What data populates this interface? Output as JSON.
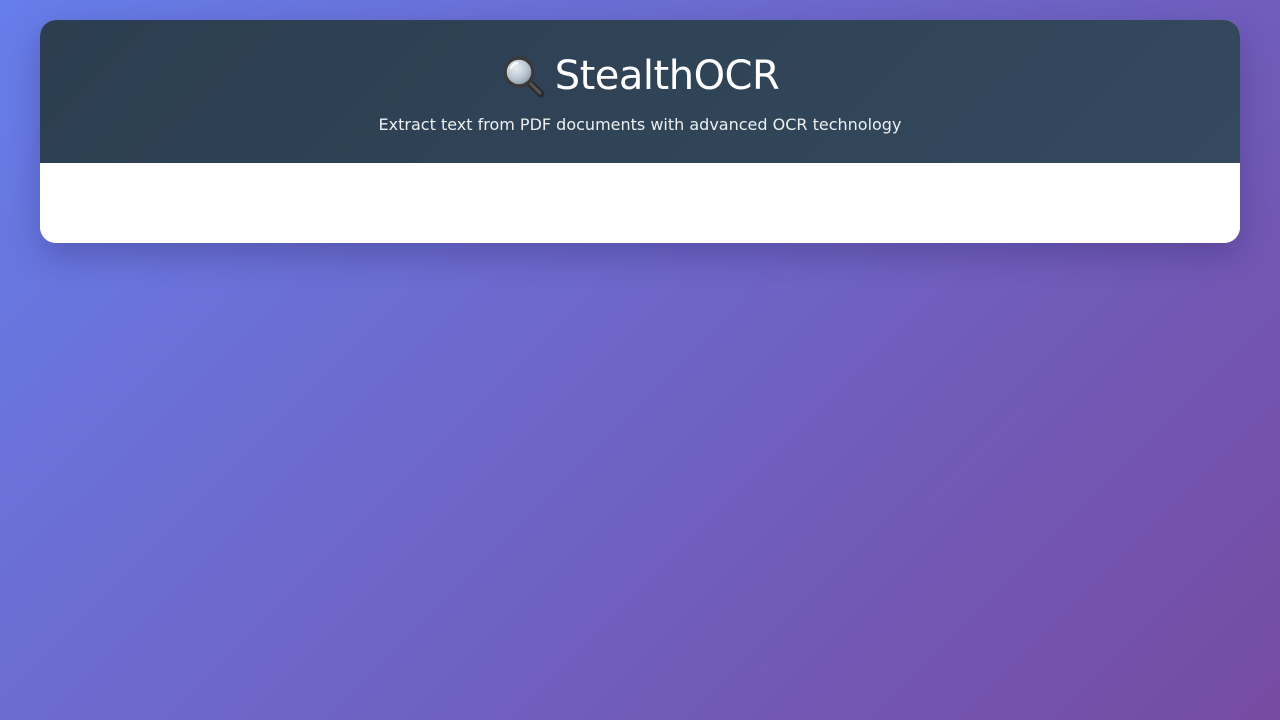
{
  "header": {
    "icon": "search-icon",
    "title": "StealthOCR",
    "subtitle": "Extract text from PDF documents with advanced OCR technology"
  },
  "colors": {
    "background_start": "#667eea",
    "background_end": "#764ba2",
    "header_bg": "#2c3e50",
    "card_bg": "#ffffff",
    "title_text": "#ffffff"
  }
}
